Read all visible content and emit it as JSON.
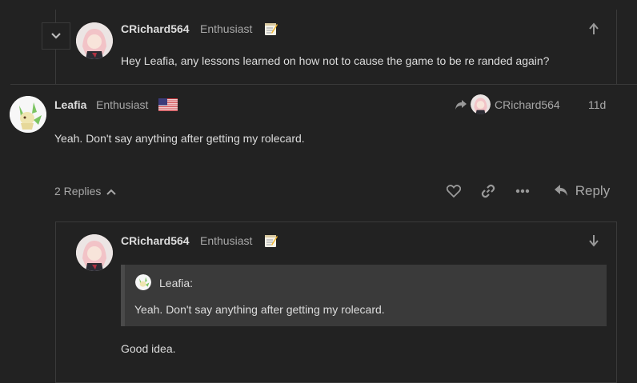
{
  "top_reply": {
    "username": "CRichard564",
    "user_title": "Enthusiast",
    "body": "Hey Leafia, any lessons learned on how not to cause the game to be re randed again?"
  },
  "main_post": {
    "username": "Leafia",
    "user_title": "Enthusiast",
    "reply_to_user": "CRichard564",
    "age": "11d",
    "body": "Yeah. Don't say anything after getting my rolecard.",
    "replies_label": "2 Replies",
    "reply_label": "Reply"
  },
  "nested_reply": {
    "username": "CRichard564",
    "user_title": "Enthusiast",
    "quote_user": "Leafia:",
    "quote_text": "Yeah. Don't say anything after getting my rolecard.",
    "body": "Good idea."
  },
  "icons": {
    "collapse": "chevron-down-icon",
    "up": "arrow-up-icon",
    "down": "arrow-down-icon",
    "reply_to": "share-arrow-icon",
    "like": "heart-icon",
    "link": "link-icon",
    "more": "ellipsis-icon",
    "reply": "reply-icon",
    "flag": "us-flag-icon",
    "memo": "memo-emoji-icon"
  },
  "colors": {
    "background": "#222222",
    "text": "#dddddd",
    "muted": "#a8a8a8",
    "border": "#3a3a3a",
    "quote_bg": "#3a3a3a"
  }
}
